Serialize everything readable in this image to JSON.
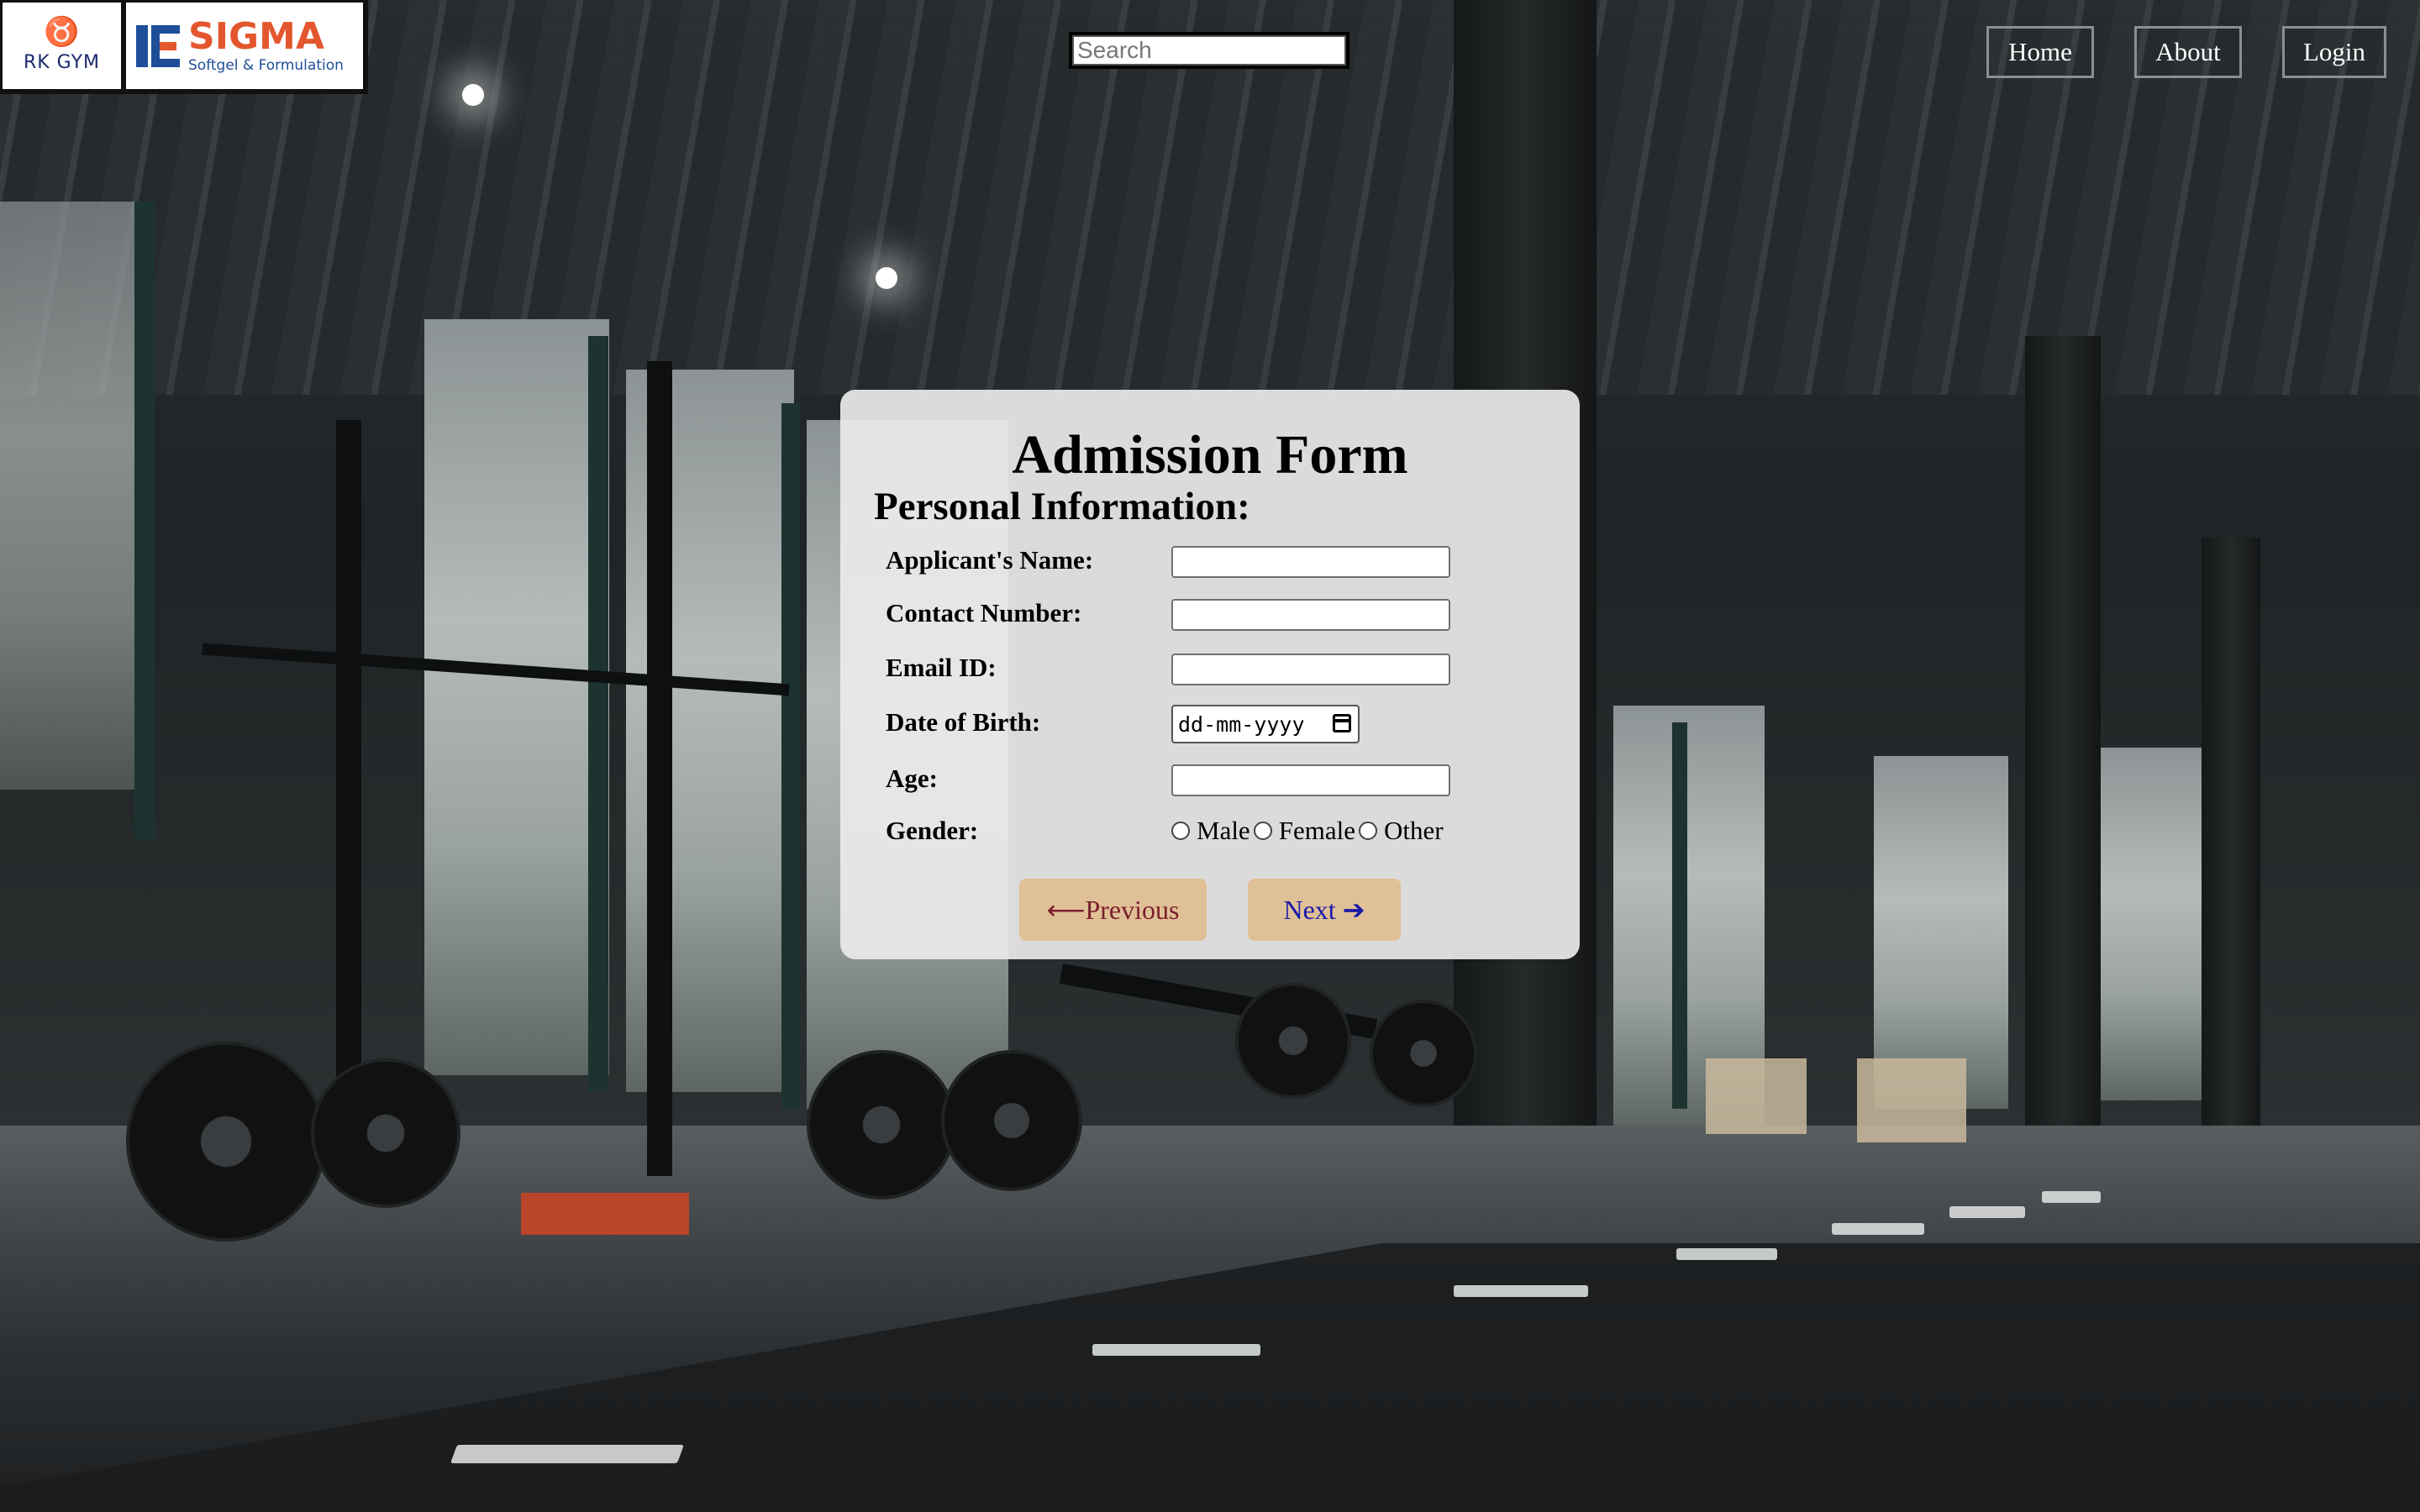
{
  "header": {
    "logo_gym": {
      "text": "RK GYM"
    },
    "logo_sigma": {
      "name": "SIGMA",
      "tagline": "Softgel & Formulation"
    },
    "search": {
      "placeholder": "Search",
      "value": ""
    },
    "nav": [
      {
        "label": "Home"
      },
      {
        "label": "About"
      },
      {
        "label": "Login"
      }
    ]
  },
  "form": {
    "title": "Admission Form",
    "section": "Personal Information:",
    "fields": {
      "name_label": "Applicant's Name:",
      "contact_label": "Contact Number:",
      "email_label": "Email ID:",
      "dob_label": "Date of Birth:",
      "dob_placeholder": "dd-mm-yyyy",
      "age_label": "Age:",
      "gender_label": "Gender:",
      "gender_options": [
        "Male",
        "Female",
        "Other"
      ]
    },
    "buttons": {
      "previous": "⟵Previous",
      "next": "Next ➔"
    }
  },
  "colors": {
    "button_bg": "#e0c097",
    "previous_text": "#7a1f2b",
    "next_text": "#1a1aa8",
    "card_bg": "#eaeaea",
    "sigma_orange": "#e4572e",
    "sigma_blue": "#1f4e99"
  }
}
